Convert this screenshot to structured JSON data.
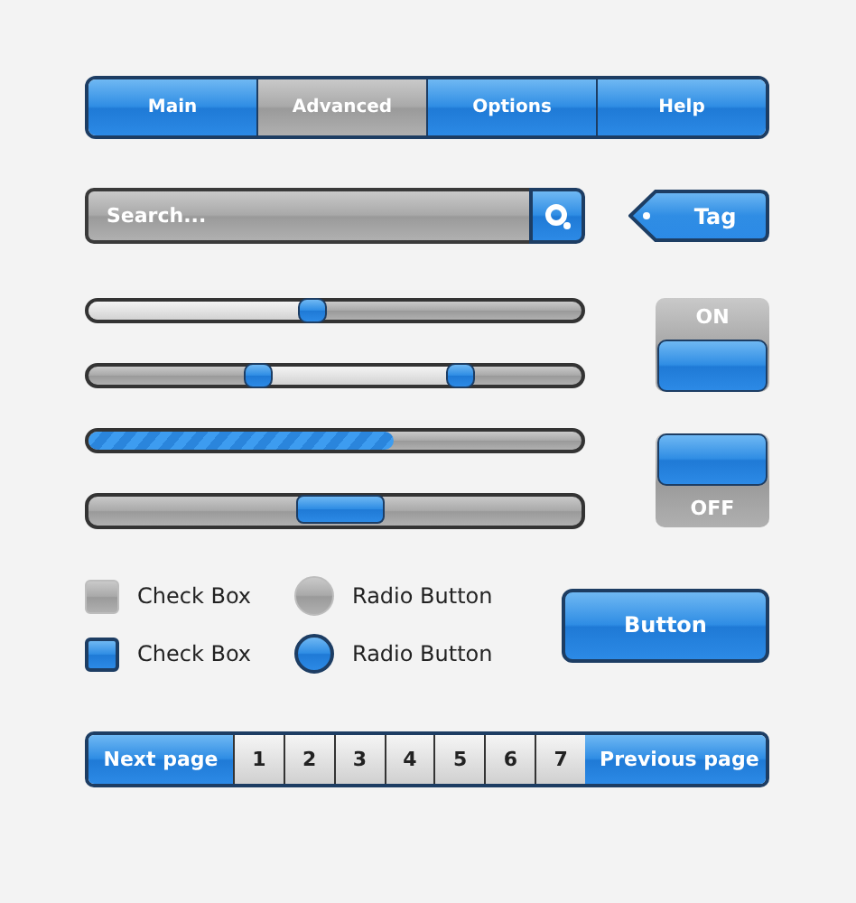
{
  "tabs": [
    {
      "label": "Main",
      "selected": false
    },
    {
      "label": "Advanced",
      "selected": true
    },
    {
      "label": "Options",
      "selected": false
    },
    {
      "label": "Help",
      "selected": false
    }
  ],
  "search": {
    "placeholder": "Search..."
  },
  "tag": {
    "label": "Tag"
  },
  "sliders": [
    {
      "kind": "single",
      "level": 0.45
    },
    {
      "kind": "range",
      "handles": [
        {
          "level": 0.34
        },
        {
          "level": 0.75
        }
      ]
    },
    {
      "kind": "progress",
      "level": 0.62
    },
    {
      "kind": "scrollbar"
    }
  ],
  "toggles": [
    {
      "label": "ON",
      "on": true
    },
    {
      "label": "OFF",
      "on": false
    }
  ],
  "checkboxes": [
    {
      "label": "Check Box",
      "checked": false
    },
    {
      "label": "Check Box",
      "checked": true
    }
  ],
  "radios": [
    {
      "label": "Radio Button",
      "selected": false
    },
    {
      "label": "Radio Button",
      "selected": true
    }
  ],
  "button": {
    "label": "Button"
  },
  "pagination": {
    "next": "Next page",
    "previous": "Previous page",
    "pages": [
      {
        "label": "1",
        "selected": false
      },
      {
        "label": "2",
        "selected": false
      },
      {
        "label": "3",
        "selected": false
      },
      {
        "label": "4",
        "selected": false
      },
      {
        "label": "5",
        "selected": false
      },
      {
        "label": "6",
        "selected": false
      },
      {
        "label": "7",
        "selected": false
      }
    ]
  }
}
